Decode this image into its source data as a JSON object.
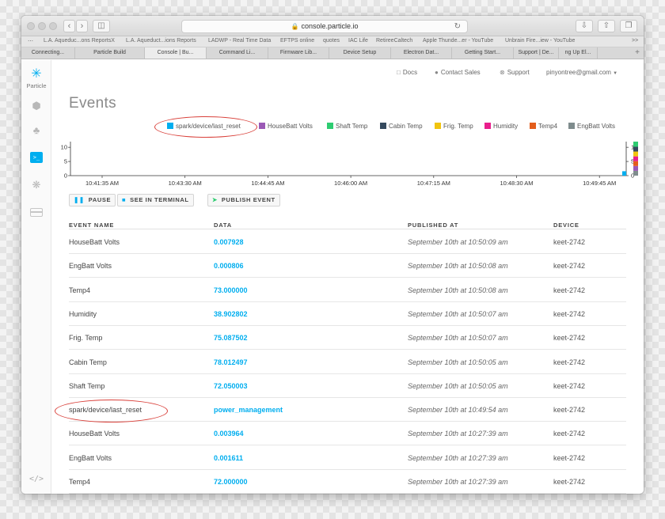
{
  "browser": {
    "url": "console.particle.io",
    "bookmarks": [
      "L.A. Aqueduc...ons ReportsX",
      "L.A. Aqueduct...ions Reports",
      "LADWP - Real Time Data",
      "EFTPS online",
      "quotes",
      "IAC Life",
      "RetireeCaltech",
      "Apple Thunde...er - YouTube",
      "Unbrain Fire...iew - YouTube"
    ],
    "bookmarks_more": ">>",
    "tabs": [
      "Connecting...",
      "Particle Build",
      "Console | Bu...",
      "Command Li...",
      "Firmware Lib...",
      "Device Setup",
      "Electron Dat...",
      "Getting Start...",
      "Support | De...",
      "ng Up El..."
    ],
    "active_tab_index": 2,
    "new_tab": "+"
  },
  "sidebar": {
    "logo_text": "Particle"
  },
  "header": {
    "docs": "Docs",
    "contact_sales": "Contact Sales",
    "support": "Support",
    "account": "pinyontree@gmail.com"
  },
  "page": {
    "title": "Events"
  },
  "legend": [
    {
      "label": "spark/device/last_reset",
      "color": "#00aeef"
    },
    {
      "label": "HouseBatt Volts",
      "color": "#9b59b6"
    },
    {
      "label": "Shaft Temp",
      "color": "#2ecc71"
    },
    {
      "label": "Cabin Temp",
      "color": "#34495e"
    },
    {
      "label": "Frig. Temp",
      "color": "#f1c40f"
    },
    {
      "label": "Humidity",
      "color": "#e91e8c"
    },
    {
      "label": "Temp4",
      "color": "#e35d1c"
    },
    {
      "label": "EngBatt Volts",
      "color": "#7f8c8d"
    }
  ],
  "chart_data": {
    "type": "bar",
    "x_ticks": [
      "10:41:35 AM",
      "10:43:30 AM",
      "10:44:45 AM",
      "10:46:00 AM",
      "10:47:15 AM",
      "10:48:30 AM",
      "10:49:45 AM"
    ],
    "y_ticks": [
      0,
      5,
      10
    ],
    "ylim": [
      0,
      12
    ],
    "series": [
      {
        "name": "spark/device/last_reset",
        "color": "#00aeef",
        "points": [
          {
            "x": "10:49:54 AM",
            "y": 1
          }
        ]
      }
    ],
    "stacked_bar": {
      "segments": [
        {
          "series": "EngBatt Volts",
          "value": 1.7,
          "color": "#7f8c8d"
        },
        {
          "series": "HouseBatt Volts",
          "value": 1.7,
          "color": "#9b59b6"
        },
        {
          "series": "Temp4",
          "value": 1.7,
          "color": "#e35d1c"
        },
        {
          "series": "Humidity",
          "value": 1.7,
          "color": "#e91e8c"
        },
        {
          "series": "Frig. Temp",
          "value": 1.7,
          "color": "#f1c40f"
        },
        {
          "series": "Cabin Temp",
          "value": 1.7,
          "color": "#34495e"
        },
        {
          "series": "Shaft Temp",
          "value": 1.8,
          "color": "#2ecc71"
        }
      ]
    }
  },
  "actions": {
    "pause": "PAUSE",
    "terminal": "SEE IN TERMINAL",
    "publish": "PUBLISH EVENT"
  },
  "table": {
    "headers": [
      "EVENT NAME",
      "DATA",
      "PUBLISHED AT",
      "DEVICE"
    ],
    "rows": [
      {
        "name": "HouseBatt Volts",
        "data": "0.007928",
        "published": "September 10th at 10:50:09 am",
        "device": "keet-2742"
      },
      {
        "name": "EngBatt Volts",
        "data": "0.000806",
        "published": "September 10th at 10:50:08 am",
        "device": "keet-2742"
      },
      {
        "name": "Temp4",
        "data": "73.000000",
        "published": "September 10th at 10:50:08 am",
        "device": "keet-2742"
      },
      {
        "name": "Humidity",
        "data": "38.902802",
        "published": "September 10th at 10:50:07 am",
        "device": "keet-2742"
      },
      {
        "name": "Frig. Temp",
        "data": "75.087502",
        "published": "September 10th at 10:50:07 am",
        "device": "keet-2742"
      },
      {
        "name": "Cabin Temp",
        "data": "78.012497",
        "published": "September 10th at 10:50:05 am",
        "device": "keet-2742"
      },
      {
        "name": "Shaft Temp",
        "data": "72.050003",
        "published": "September 10th at 10:50:05 am",
        "device": "keet-2742"
      },
      {
        "name": "spark/device/last_reset",
        "data": "power_management",
        "published": "September 10th at 10:49:54 am",
        "device": "keet-2742"
      },
      {
        "name": "HouseBatt Volts",
        "data": "0.003964",
        "published": "September 10th at 10:27:39 am",
        "device": "keet-2742"
      },
      {
        "name": "EngBatt Volts",
        "data": "0.001611",
        "published": "September 10th at 10:27:39 am",
        "device": "keet-2742"
      },
      {
        "name": "Temp4",
        "data": "72.000000",
        "published": "September 10th at 10:27:39 am",
        "device": "keet-2742"
      }
    ]
  },
  "annotation_color": "#d9403a"
}
